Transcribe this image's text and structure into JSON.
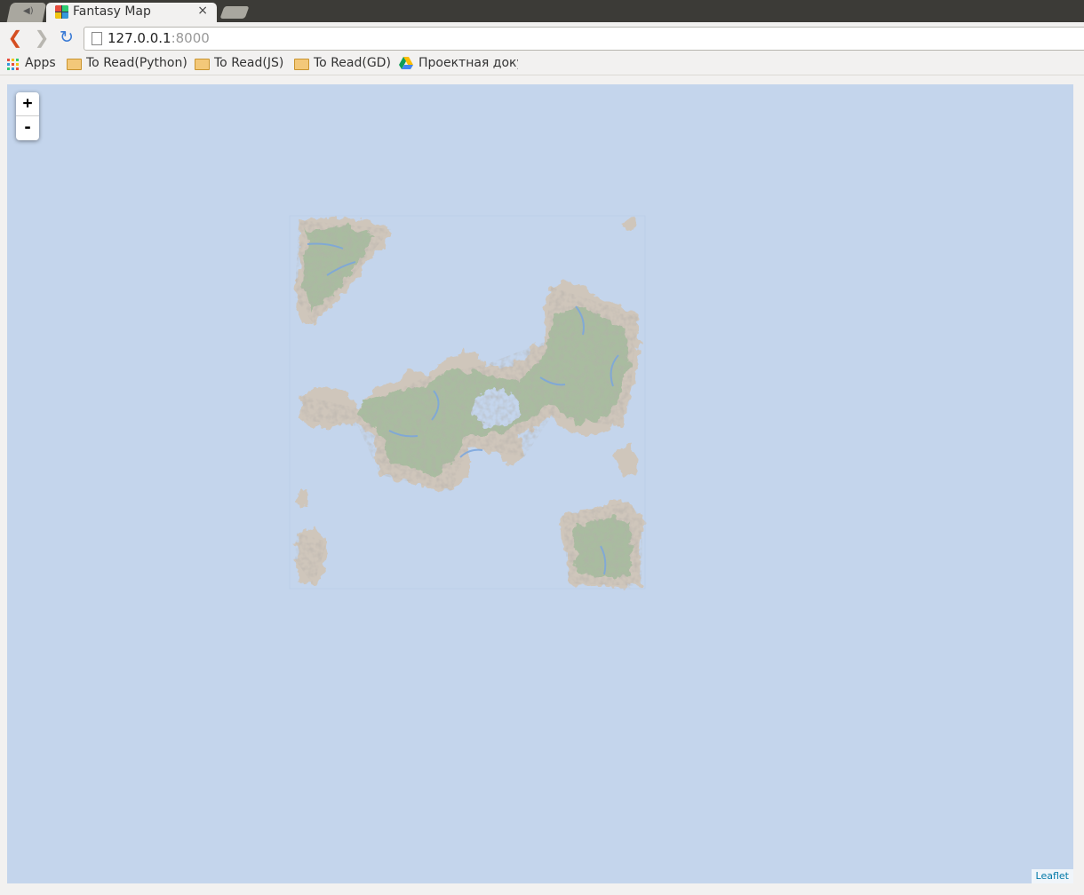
{
  "browser": {
    "tabs": [
      {
        "label": "",
        "kind": "audio-tab"
      },
      {
        "label": "Fantasy Map",
        "active": true
      },
      {
        "label": "",
        "kind": "new-tab"
      }
    ],
    "close_glyph": "×",
    "url": {
      "host": "127.0.0.1",
      "port": ":8000"
    },
    "icons": {
      "back": "back-arrow-icon",
      "forward": "forward-arrow-icon",
      "reload": "reload-icon",
      "page": "page-icon"
    }
  },
  "bookmarks": [
    {
      "label": "Apps",
      "icon": "apps-grid-icon"
    },
    {
      "label": "To Read(Python)",
      "icon": "folder-icon"
    },
    {
      "label": "To Read(JS)",
      "icon": "folder-icon"
    },
    {
      "label": "To Read(GD)",
      "icon": "folder-icon"
    },
    {
      "label": "Проектная докум",
      "icon": "google-drive-icon"
    }
  ],
  "map": {
    "zoom_in": "+",
    "zoom_out": "-",
    "attribution": "Leaflet",
    "colors": {
      "water": "#c4d5ec",
      "land": "#a9bca0",
      "mountain": "#cfc6bb",
      "river": "#7aa6de"
    }
  }
}
